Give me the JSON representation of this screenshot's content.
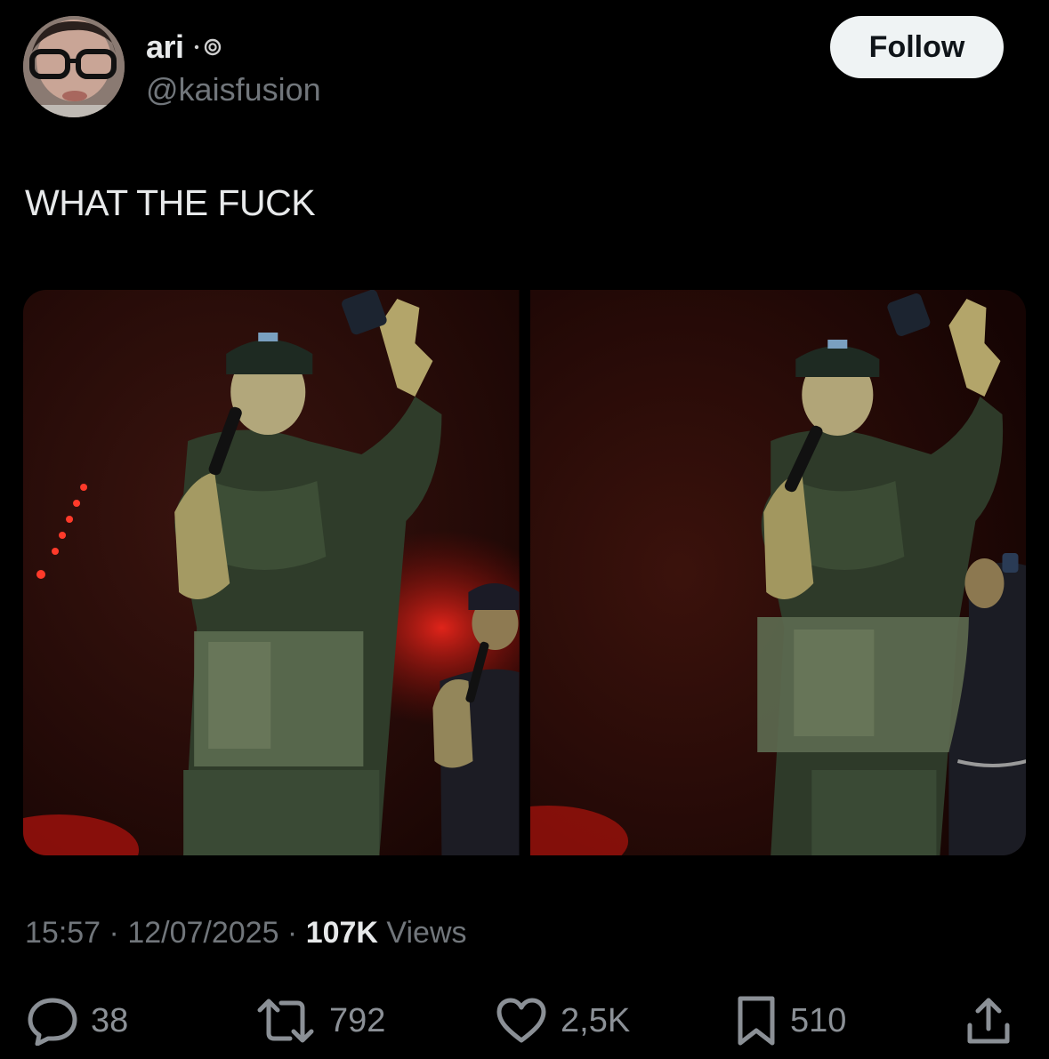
{
  "author": {
    "display_name": "ari",
    "name_emoji": "⋆ ◎",
    "handle": "@kaisfusion"
  },
  "follow_label": "Follow",
  "tweet_text": "WHAT THE FUCK",
  "meta": {
    "time": "15:57",
    "separator": " · ",
    "date": "12/07/2025",
    "views_count": "107K",
    "views_label": " Views"
  },
  "actions": {
    "replies": "38",
    "reposts": "792",
    "likes": "2,5K",
    "bookmarks": "510"
  },
  "colors": {
    "background": "#000000",
    "text_primary": "#e7e9ea",
    "text_secondary": "#71767b",
    "follow_bg": "#eff3f4",
    "stage_red": "#c21a14"
  },
  "icons": [
    "reply-icon",
    "repost-icon",
    "like-icon",
    "bookmark-icon",
    "share-icon",
    "spiral-icon"
  ]
}
